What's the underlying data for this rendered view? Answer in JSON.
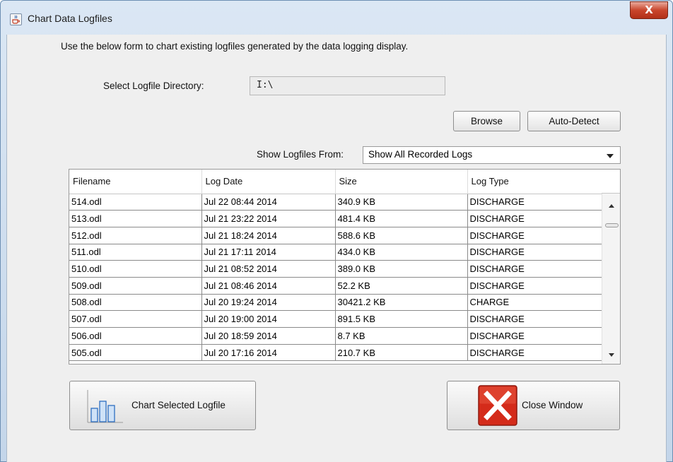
{
  "window": {
    "title": "Chart Data Logfiles",
    "close_glyph": "X"
  },
  "intro_text": "Use the below form to chart existing logfiles generated by the data logging display.",
  "directory": {
    "label": "Select Logfile Directory:",
    "value": "I:\\",
    "browse_label": "Browse",
    "autodetect_label": "Auto-Detect"
  },
  "filter": {
    "label": "Show Logfiles From:",
    "selected": "Show All Recorded Logs"
  },
  "table": {
    "columns": [
      "Filename",
      "Log Date",
      "Size",
      "Log Type"
    ],
    "rows": [
      [
        "514.odl",
        "Jul 22 08:44 2014",
        "340.9 KB",
        "DISCHARGE"
      ],
      [
        "513.odl",
        "Jul 21 23:22 2014",
        "481.4 KB",
        "DISCHARGE"
      ],
      [
        "512.odl",
        "Jul 21 18:24 2014",
        "588.6 KB",
        "DISCHARGE"
      ],
      [
        "511.odl",
        "Jul 21 17:11 2014",
        "434.0 KB",
        "DISCHARGE"
      ],
      [
        "510.odl",
        "Jul 21 08:52 2014",
        "389.0 KB",
        "DISCHARGE"
      ],
      [
        "509.odl",
        "Jul 21 08:46 2014",
        "52.2 KB",
        "DISCHARGE"
      ],
      [
        "508.odl",
        "Jul 20 19:24 2014",
        "30421.2 KB",
        "CHARGE"
      ],
      [
        "507.odl",
        "Jul 20 19:00 2014",
        "891.5 KB",
        "DISCHARGE"
      ],
      [
        "506.odl",
        "Jul 20 18:59 2014",
        "8.7 KB",
        "DISCHARGE"
      ],
      [
        "505.odl",
        "Jul 20 17:16 2014",
        "210.7 KB",
        "DISCHARGE"
      ]
    ]
  },
  "actions": {
    "chart_label": "Chart Selected Logfile",
    "close_label": "Close Window"
  },
  "icons": {
    "title": "java-cup-icon",
    "chart": "bar-chart-icon",
    "close": "red-x-icon"
  }
}
